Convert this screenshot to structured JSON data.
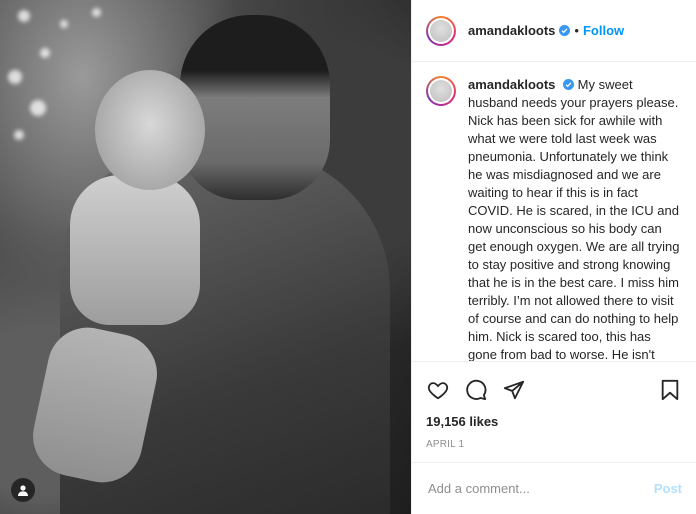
{
  "post": {
    "username": "amandakloots",
    "verified_icon": "verified-badge-icon",
    "separator": "•",
    "follow_label": "Follow",
    "caption": {
      "username": "amandakloots",
      "text": "My sweet husband needs your prayers please. Nick has been sick for awhile with what we were told last week was pneumonia. Unfortunately we think he was misdiagnosed and we are waiting to hear if this is in fact COVID. He is scared, in the ICU and now unconscious so his body can get enough oxygen. We are all trying to stay positive and strong knowing that he is in the best care. I miss him terribly. I’m not allowed there to visit of course and can do nothing to help him. Nick is scared too, this has gone from bad to worse. He isn't allowed to eat or drink, he is very weak and having a hard time breathing. Elvis and I are feeling completely fine. My hubby is"
    },
    "likes": "19,156 likes",
    "date": "APRIL 1",
    "comment": {
      "placeholder": "Add a comment...",
      "post_label": "Post"
    },
    "icons": [
      "heart-icon",
      "comment-icon",
      "share-icon",
      "bookmark-icon",
      "user-tag-icon"
    ],
    "colors": {
      "accent": "#0095f6",
      "post_disabled": "#b2dffc",
      "muted": "#8e8e8e"
    }
  }
}
